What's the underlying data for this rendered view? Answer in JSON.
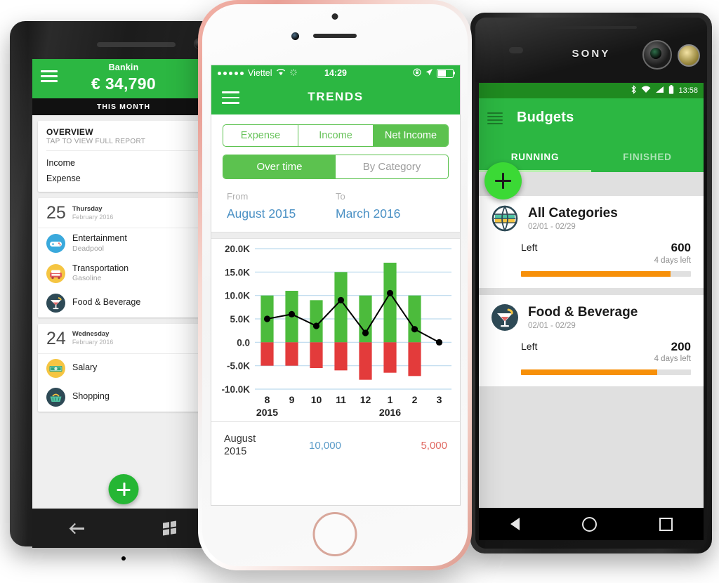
{
  "windows_phone": {
    "platform": "Windows Phone",
    "header": {
      "bank_name": "Bankin",
      "balance": "€ 34,790",
      "menu_icon": "hamburger-icon"
    },
    "month_bar": "THIS MONTH",
    "overview": {
      "title": "OVERVIEW",
      "subtitle": "TAP TO VIEW FULL REPORT",
      "rows": [
        {
          "label": "Income"
        },
        {
          "label": "Expense"
        }
      ]
    },
    "day_groups": [
      {
        "day_number": "25",
        "weekday": "Thursday",
        "month_year": "February 2016",
        "transactions": [
          {
            "category": "Entertainment",
            "note": "Deadpool",
            "icon": "gamepad-icon",
            "icon_bg": "#3aa9dc"
          },
          {
            "category": "Transportation",
            "note": "Gasoline",
            "icon": "car-icon",
            "icon_bg": "#f5c542"
          },
          {
            "category": "Food & Beverage",
            "note": "",
            "icon": "cocktail-icon",
            "icon_bg": "#2e4a56"
          }
        ]
      },
      {
        "day_number": "24",
        "weekday": "Wednesday",
        "month_year": "February 2016",
        "transactions": [
          {
            "category": "Salary",
            "note": "",
            "icon": "banknote-icon",
            "icon_bg": "#f5c542"
          },
          {
            "category": "Shopping",
            "note": "",
            "icon": "basket-icon",
            "icon_bg": "#2e4a56"
          }
        ]
      }
    ],
    "fab": {
      "icon": "plus-icon",
      "color": "#25b634"
    },
    "nav": {
      "back": "back-arrow-icon",
      "home": "windows-logo-icon"
    }
  },
  "iphone": {
    "platform": "iPhone",
    "status_bar": {
      "signal_dots": 5,
      "carrier": "Viettel",
      "wifi_icon": "wifi-icon",
      "sync_icon": "sync-icon",
      "time": "14:29",
      "lock_rotation_icon": "rotation-lock-icon",
      "location_icon": "location-arrow-icon",
      "battery_icon": "battery-icon"
    },
    "app_bar": {
      "menu_icon": "hamburger-icon",
      "title": "TRENDS"
    },
    "segment_type": {
      "options": [
        "Expense",
        "Income",
        "Net Income"
      ],
      "selected": "Net Income"
    },
    "segment_view": {
      "options": [
        "Over time",
        "By Category"
      ],
      "selected": "Over time"
    },
    "date_range": {
      "from_label": "From",
      "from_value": "August 2015",
      "to_label": "To",
      "to_value": "March 2016"
    },
    "footer": {
      "month": "August",
      "year": "2015",
      "income": "10,000",
      "expense": "5,000"
    }
  },
  "chart_data": {
    "type": "bar",
    "title": "Net Income Over Time",
    "xlabel": "",
    "ylabel": "",
    "ylim": [
      -10000,
      20000
    ],
    "ytick_labels": [
      "20.0K",
      "15.0K",
      "10.0K",
      "5.0K",
      "0.0",
      "-5.0K",
      "-10.0K"
    ],
    "ytick_values": [
      20000,
      15000,
      10000,
      5000,
      0,
      -5000,
      -10000
    ],
    "categories": [
      "8",
      "9",
      "10",
      "11",
      "12",
      "1",
      "2",
      "3"
    ],
    "year_labels": [
      {
        "text": "2015",
        "under_category": "8"
      },
      {
        "text": "2016",
        "under_category": "1"
      }
    ],
    "grid": true,
    "legend": "none",
    "series": [
      {
        "name": "Income",
        "type": "bar",
        "color": "#4CBB3C",
        "values": [
          10000,
          11000,
          9000,
          15000,
          10000,
          17000,
          10000,
          0
        ]
      },
      {
        "name": "Expense",
        "type": "bar",
        "color": "#E33B3B",
        "values": [
          -5000,
          -5000,
          -5500,
          -6000,
          -8000,
          -6500,
          -7200,
          0
        ]
      },
      {
        "name": "Net Income",
        "type": "line",
        "color": "#000000",
        "values": [
          5000,
          6000,
          3500,
          9000,
          2000,
          10500,
          2800,
          0
        ]
      }
    ]
  },
  "sony_phone": {
    "platform": "Android",
    "brand": "SONY",
    "status_bar": {
      "bluetooth_icon": "bluetooth-icon",
      "wifi_icon": "wifi-icon",
      "signal_icon": "signal-icon",
      "battery_icon": "battery-icon",
      "time": "13:58"
    },
    "app_bar": {
      "menu_icon": "hamburger-icon",
      "title": "Budgets"
    },
    "tabs": [
      {
        "label": "RUNNING",
        "active": true
      },
      {
        "label": "FINISHED",
        "active": false
      }
    ],
    "fab": {
      "icon": "plus-icon",
      "color": "#3bd935"
    },
    "budgets": [
      {
        "name": "All Categories",
        "date_range": "02/01 - 02/29",
        "icon": "globe-icon",
        "left_label": "Left",
        "amount": "600",
        "days_left": "4 days left",
        "progress_percent": 88,
        "progress_color": "#f79009"
      },
      {
        "name": "Food & Beverage",
        "date_range": "02/01 - 02/29",
        "icon": "cocktail-icon",
        "left_label": "Left",
        "amount": "200",
        "days_left": "4 days left",
        "progress_percent": 80,
        "progress_color": "#f79009"
      }
    ],
    "nav": {
      "back": "back-triangle-icon",
      "home": "home-circle-icon",
      "recents": "recents-square-icon"
    }
  }
}
